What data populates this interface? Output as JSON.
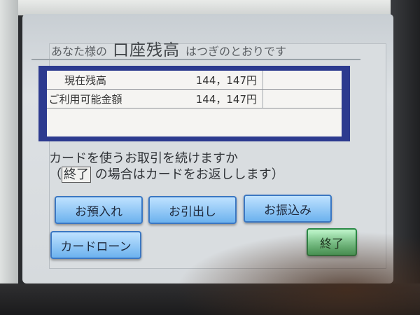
{
  "header": {
    "prefix": "あなた様の",
    "main": "口座残高",
    "suffix": "はつぎのとおりです"
  },
  "balance": {
    "rows": [
      {
        "label": "現在残高",
        "value": "144，147円"
      },
      {
        "label": "ご利用可能金額",
        "value": "144，147円"
      }
    ]
  },
  "message": {
    "line1": "カードを使うお取引を続けますか",
    "paren_open": "（",
    "keyword": "終了",
    "line2_rest": "の場合はカードをお返しします）"
  },
  "buttons": {
    "deposit": "お預入れ",
    "withdraw": "お引出し",
    "transfer": "お振込み",
    "card_loan": "カードローン",
    "end": "終了"
  }
}
